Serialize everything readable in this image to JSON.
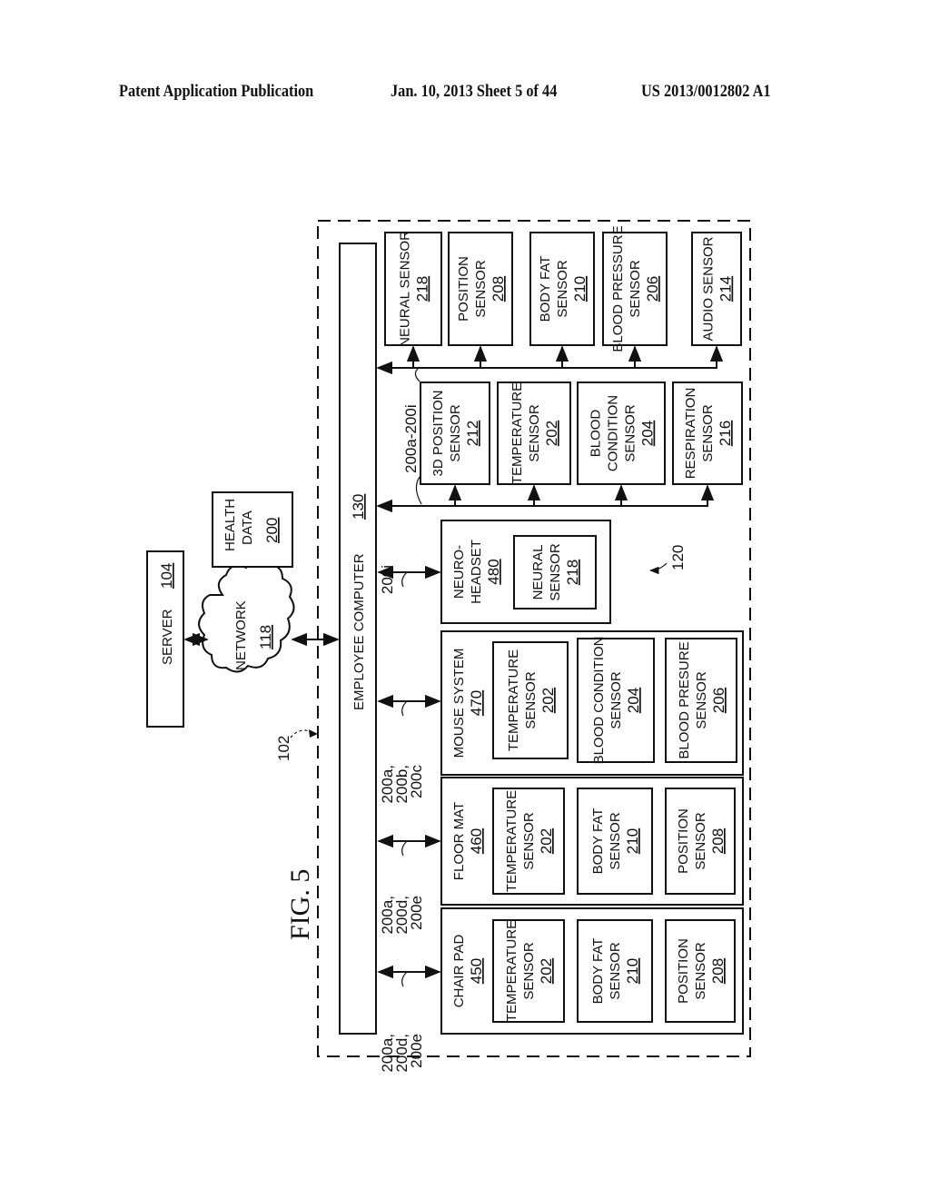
{
  "header": {
    "left": "Patent Application Publication",
    "middle": "Jan. 10, 2013   Sheet 5 of 44",
    "right": "US 2013/0012802 A1"
  },
  "figure": {
    "title": "FIG. 5",
    "system_ref": "102",
    "sensor_group_ref": "120",
    "server": {
      "label": "SERVER",
      "ref": "104"
    },
    "network": {
      "label": "NETWORK",
      "ref": "118",
      "icon": "cloud-icon"
    },
    "health_data": {
      "line1": "HEALTH",
      "line2": "DATA",
      "ref": "200"
    },
    "employee_computer": {
      "label": "EMPLOYEE COMPUTER",
      "ref": "130"
    },
    "top_bus_sensors": [
      {
        "lines": [
          "NEURAL SENSOR"
        ],
        "ref": "218"
      },
      {
        "lines": [
          "POSITION",
          "SENSOR"
        ],
        "ref": "208"
      },
      {
        "lines": [
          "BODY FAT",
          "SENSOR"
        ],
        "ref": "210"
      },
      {
        "lines": [
          "BLOOD PRESSURE",
          "SENSOR"
        ],
        "ref": "206"
      },
      {
        "lines": [
          "AUDIO SENSOR"
        ],
        "ref": "214"
      }
    ],
    "mid_bus_label": "200a-200i",
    "mid_bus_sensors": [
      {
        "lines": [
          "3D POSITION",
          "SENSOR"
        ],
        "ref": "212"
      },
      {
        "lines": [
          "TEMPERATURE",
          "SENSOR"
        ],
        "ref": "202"
      },
      {
        "lines": [
          "BLOOD",
          "CONDITION",
          "SENSOR"
        ],
        "ref": "204"
      },
      {
        "lines": [
          "RESPIRATION",
          "SENSOR"
        ],
        "ref": "216"
      }
    ],
    "neuro_headset": {
      "lines": [
        "NEURO-",
        "HEADSET"
      ],
      "ref": "480",
      "link_label": "200i",
      "sensors": [
        {
          "lines": [
            "NEURAL",
            "SENSOR"
          ],
          "ref": "218"
        }
      ]
    },
    "mouse_system": {
      "lines": [
        "MOUSE SYSTEM"
      ],
      "ref": "470",
      "link_label": [
        "200a,",
        "200b,",
        "200c"
      ],
      "sensors": [
        {
          "lines": [
            "TEMPERATURE",
            "SENSOR"
          ],
          "ref": "202"
        },
        {
          "lines": [
            "BLOOD CONDITION",
            "SENSOR"
          ],
          "ref": "204"
        },
        {
          "lines": [
            "BLOOD PRESURE",
            "SENSOR"
          ],
          "ref": "206"
        }
      ]
    },
    "floor_mat": {
      "lines": [
        "FLOOR MAT"
      ],
      "ref": "460",
      "link_label": [
        "200a,",
        "200d,",
        "200e"
      ],
      "sensors": [
        {
          "lines": [
            "TEMPERATURE",
            "SENSOR"
          ],
          "ref": "202"
        },
        {
          "lines": [
            "BODY FAT",
            "SENSOR"
          ],
          "ref": "210"
        },
        {
          "lines": [
            "POSITION",
            "SENSOR"
          ],
          "ref": "208"
        }
      ]
    },
    "chair_pad": {
      "lines": [
        "CHAIR PAD"
      ],
      "ref": "450",
      "link_label": [
        "200a,",
        "200d,",
        "200e"
      ],
      "sensors": [
        {
          "lines": [
            "TEMPERATURE",
            "SENSOR"
          ],
          "ref": "202"
        },
        {
          "lines": [
            "BODY FAT",
            "SENSOR"
          ],
          "ref": "210"
        },
        {
          "lines": [
            "POSITION",
            "SENSOR"
          ],
          "ref": "208"
        }
      ]
    }
  }
}
